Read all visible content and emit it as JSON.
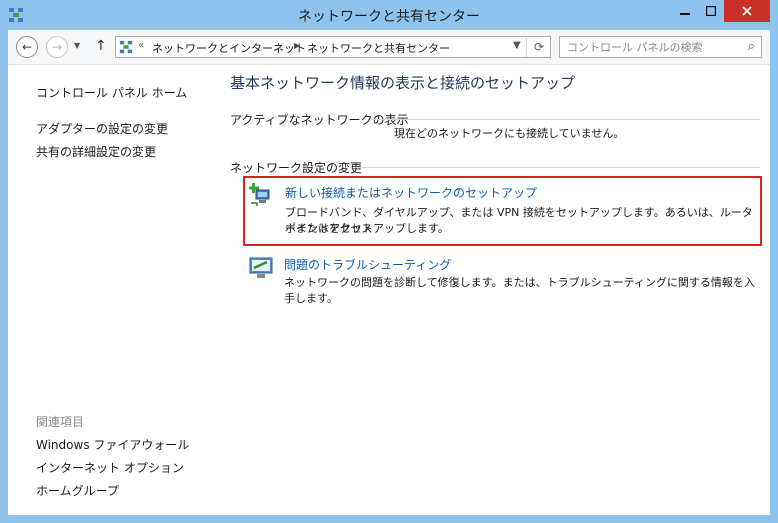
{
  "window": {
    "title": "ネットワークと共有センター"
  },
  "toolbar": {
    "breadcrumb": [
      "ネットワークとインターネット",
      "ネットワークと共有センター"
    ],
    "search_placeholder": "コントロール パネルの検索"
  },
  "sidebar": {
    "home": "コントロール パネル ホーム",
    "links": [
      "アダプターの設定の変更",
      "共有の詳細設定の変更"
    ],
    "related_heading": "関連項目",
    "related": [
      "Windows ファイアウォール",
      "インターネット オプション",
      "ホームグループ"
    ]
  },
  "main": {
    "title": "基本ネットワーク情報の表示と接続のセットアップ",
    "active_heading": "アクティブなネットワークの表示",
    "active_status": "現在どのネットワークにも接続していません。",
    "settings_heading": "ネットワーク設定の変更",
    "tasks": [
      {
        "link": "新しい接続またはネットワークのセットアップ",
        "desc_line1": "ブロードバンド、ダイヤルアップ、または VPN 接続をセットアップします。あるいは、ルーターまたはアクセス",
        "desc_line2": "ポイントをセットアップします。"
      },
      {
        "link": "問題のトラブルシューティング",
        "desc_line1": "ネットワークの問題を診断して修復します。または、トラブルシューティングに関する情報を入手します。"
      }
    ]
  },
  "colors": {
    "frame": "#8fc3ee",
    "link": "#0b5cad",
    "title": "#1e395b",
    "highlight": "#d9231f",
    "close": "#c7312a"
  }
}
